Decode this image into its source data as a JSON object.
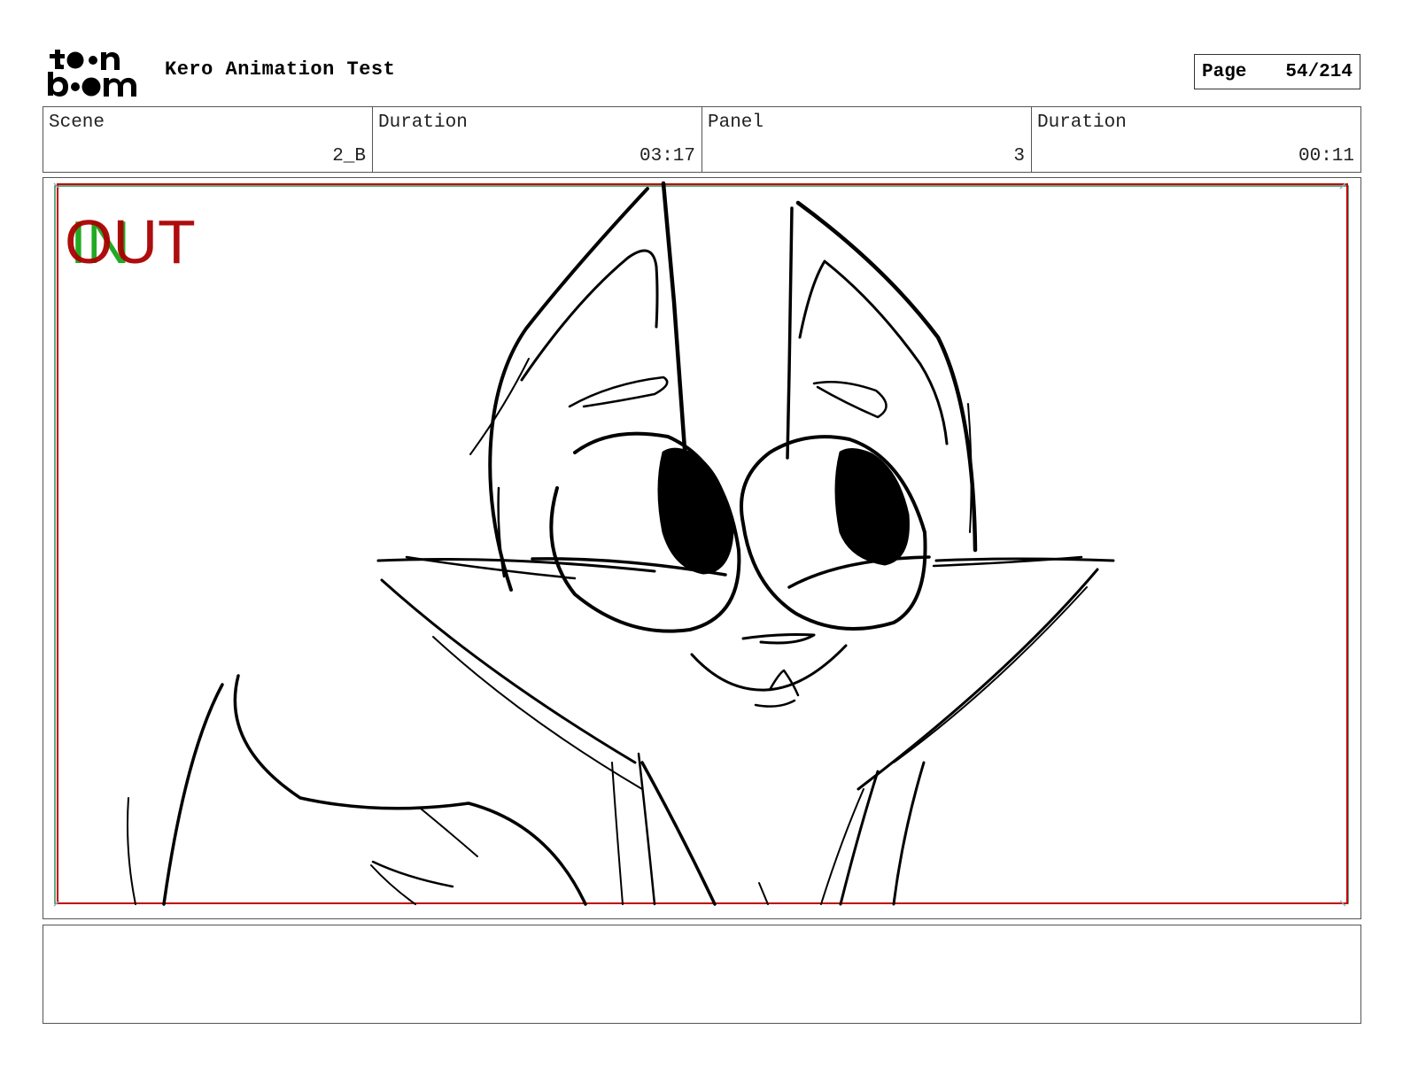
{
  "header": {
    "logo_top": "toon",
    "logo_bottom": "boom",
    "project_title": "Kero Animation Test",
    "page_label": "Page",
    "page_number": "54/214"
  },
  "info": {
    "scene_label": "Scene",
    "scene_value": "2_B",
    "scene_duration_label": "Duration",
    "scene_duration_value": "03:17",
    "panel_label": "Panel",
    "panel_value": "3",
    "panel_duration_label": "Duration",
    "panel_duration_value": "00:11"
  },
  "panel": {
    "in_label": "IN",
    "out_label": "OUT",
    "in_color": "#22aa22",
    "out_color": "#aa0000",
    "safe_frame_color": "#c00000",
    "title_safe_color": "#2e8b57"
  },
  "notes": {
    "text": ""
  }
}
